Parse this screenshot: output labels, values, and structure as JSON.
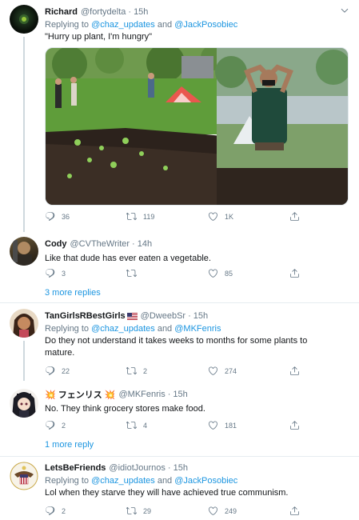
{
  "tweets": [
    {
      "name": "Richard",
      "handle": "@fortydelta",
      "sep": "·",
      "time": "15h",
      "reply_prefix": "Replying to ",
      "reply_user1": "@chaz_updates",
      "reply_and": " and ",
      "reply_user2": "@JackPosobiec",
      "text": "\"Hurry up plant, I'm hungry\"",
      "replies": "36",
      "retweets": "119",
      "likes": "1K"
    },
    {
      "name": "Cody",
      "handle": "@CVTheWriter",
      "sep": "·",
      "time": "14h",
      "text": "Like that dude has ever eaten a vegetable.",
      "replies": "3",
      "retweets": "",
      "likes": "85",
      "more_replies": "3 more replies"
    },
    {
      "name": "TanGirlsRBestGirls",
      "handle": "@DweebSr",
      "sep": "·",
      "time": "15h",
      "reply_prefix": "Replying to ",
      "reply_user1": "@chaz_updates",
      "reply_and": " and ",
      "reply_user2": "@MKFenris",
      "text": "Do they not understand it takes weeks to months for some plants to mature.",
      "replies": "22",
      "retweets": "2",
      "likes": "274"
    },
    {
      "name": "💥 フェンリス 💥",
      "handle": "@MKFenris",
      "sep": "·",
      "time": "15h",
      "text": "No. They think grocery stores make food.",
      "replies": "2",
      "retweets": "4",
      "likes": "181",
      "more_replies": "1 more reply"
    },
    {
      "name": "LetsBeFriends",
      "handle": "@idiotJournos",
      "sep": "·",
      "time": "15h",
      "reply_prefix": "Replying to ",
      "reply_user1": "@chaz_updates",
      "reply_and": " and ",
      "reply_user2": "@JackPosobiec",
      "text": "Lol when they starve they will have achieved true communism.",
      "replies": "2",
      "retweets": "29",
      "likes": "249"
    }
  ],
  "colors": {
    "link": "#1b95e0",
    "muted": "#657786",
    "divider": "#e6ecf0"
  },
  "icons": [
    "reply-icon",
    "retweet-icon",
    "like-icon",
    "share-icon",
    "caret-down-icon"
  ]
}
